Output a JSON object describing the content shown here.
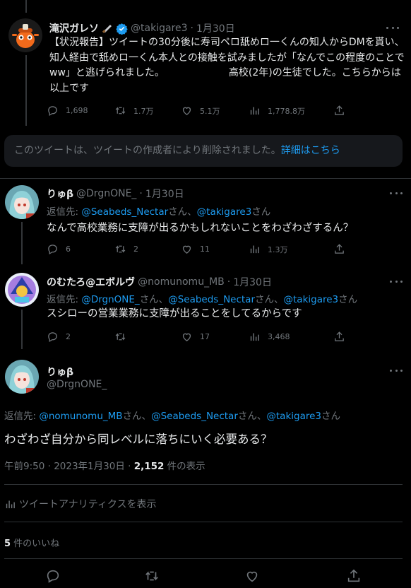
{
  "tweet1": {
    "name": "滝沢ガレソ",
    "handle": "@takigare3",
    "sep": "·",
    "date": "1月30日",
    "text": "【状況報告】ツイートの30分後に寿司ペロ舐めロ一くんの知人からDMを貰い、知人経由で舐めロ一くん本人との接触を試みましたが「なんでこの程度のことでww」と逃げられました。　　　　　　　高校(2年)の生徒でした。こちらからは以上です",
    "replies": "1,698",
    "retweets": "1.7万",
    "likes": "5.1万",
    "views": "1,778.8万"
  },
  "deleted": {
    "text": "このツイートは、ツイートの作成者により削除されました。",
    "link": "詳細はこちら"
  },
  "tweet2": {
    "name": "りゅβ",
    "handle": "@DrgnONE_",
    "sep": "·",
    "date": "1月30日",
    "reply_prefix": "返信先: ",
    "mention1": "@Seabeds_Nectar",
    "san1": "さん、",
    "mention2": "@takigare3",
    "san2": "さん",
    "text": "なんで高校業務に支障が出るかもしれないことをわざわざするん？",
    "replies": "6",
    "retweets": "2",
    "likes": "11",
    "views": "1.3万"
  },
  "tweet3": {
    "name": "のむたろ@エボルヴ",
    "handle": "@nomunomu_MB",
    "sep": "·",
    "date": "1月30日",
    "reply_prefix": "返信先: ",
    "mention1": "@DrgnONE_",
    "san1": "さん、",
    "mention2": "@Seabeds_Nectar",
    "san2": "さん、",
    "mention3": "@takigare3",
    "san3": "さん",
    "text": "スシローの営業業務に支障が出ることをしてるからです",
    "replies": "2",
    "retweets": "",
    "likes": "17",
    "views": "3,468"
  },
  "main": {
    "name": "りゅβ",
    "handle": "@DrgnONE_",
    "reply_prefix": "返信先: ",
    "mention1": "@nomunomu_MB",
    "san1": "さん、",
    "mention2": "@Seabeds_Nectar",
    "san2": "さん、",
    "mention3": "@takigare3",
    "san3": "さん",
    "text": "わざわざ自分から同レベルに落ちにいく必要ある？",
    "time": "午前9:50 · 2023年1月30日 · ",
    "view_count": "2,152",
    "view_label": " 件の表示",
    "analytics": "ツイートアナリティクスを表示",
    "likes_count": "5",
    "likes_label": " 件のいいね"
  },
  "colors": {
    "background": "#000000",
    "text": "#e7e9ea",
    "muted": "#71767b",
    "link": "#1d9bf0",
    "divider": "#2f3336",
    "verified": "#1d9bf0"
  },
  "icons": [
    "reply-icon",
    "retweet-icon",
    "like-icon",
    "views-icon",
    "share-icon",
    "more-icon",
    "verified-icon",
    "analytics-icon"
  ]
}
